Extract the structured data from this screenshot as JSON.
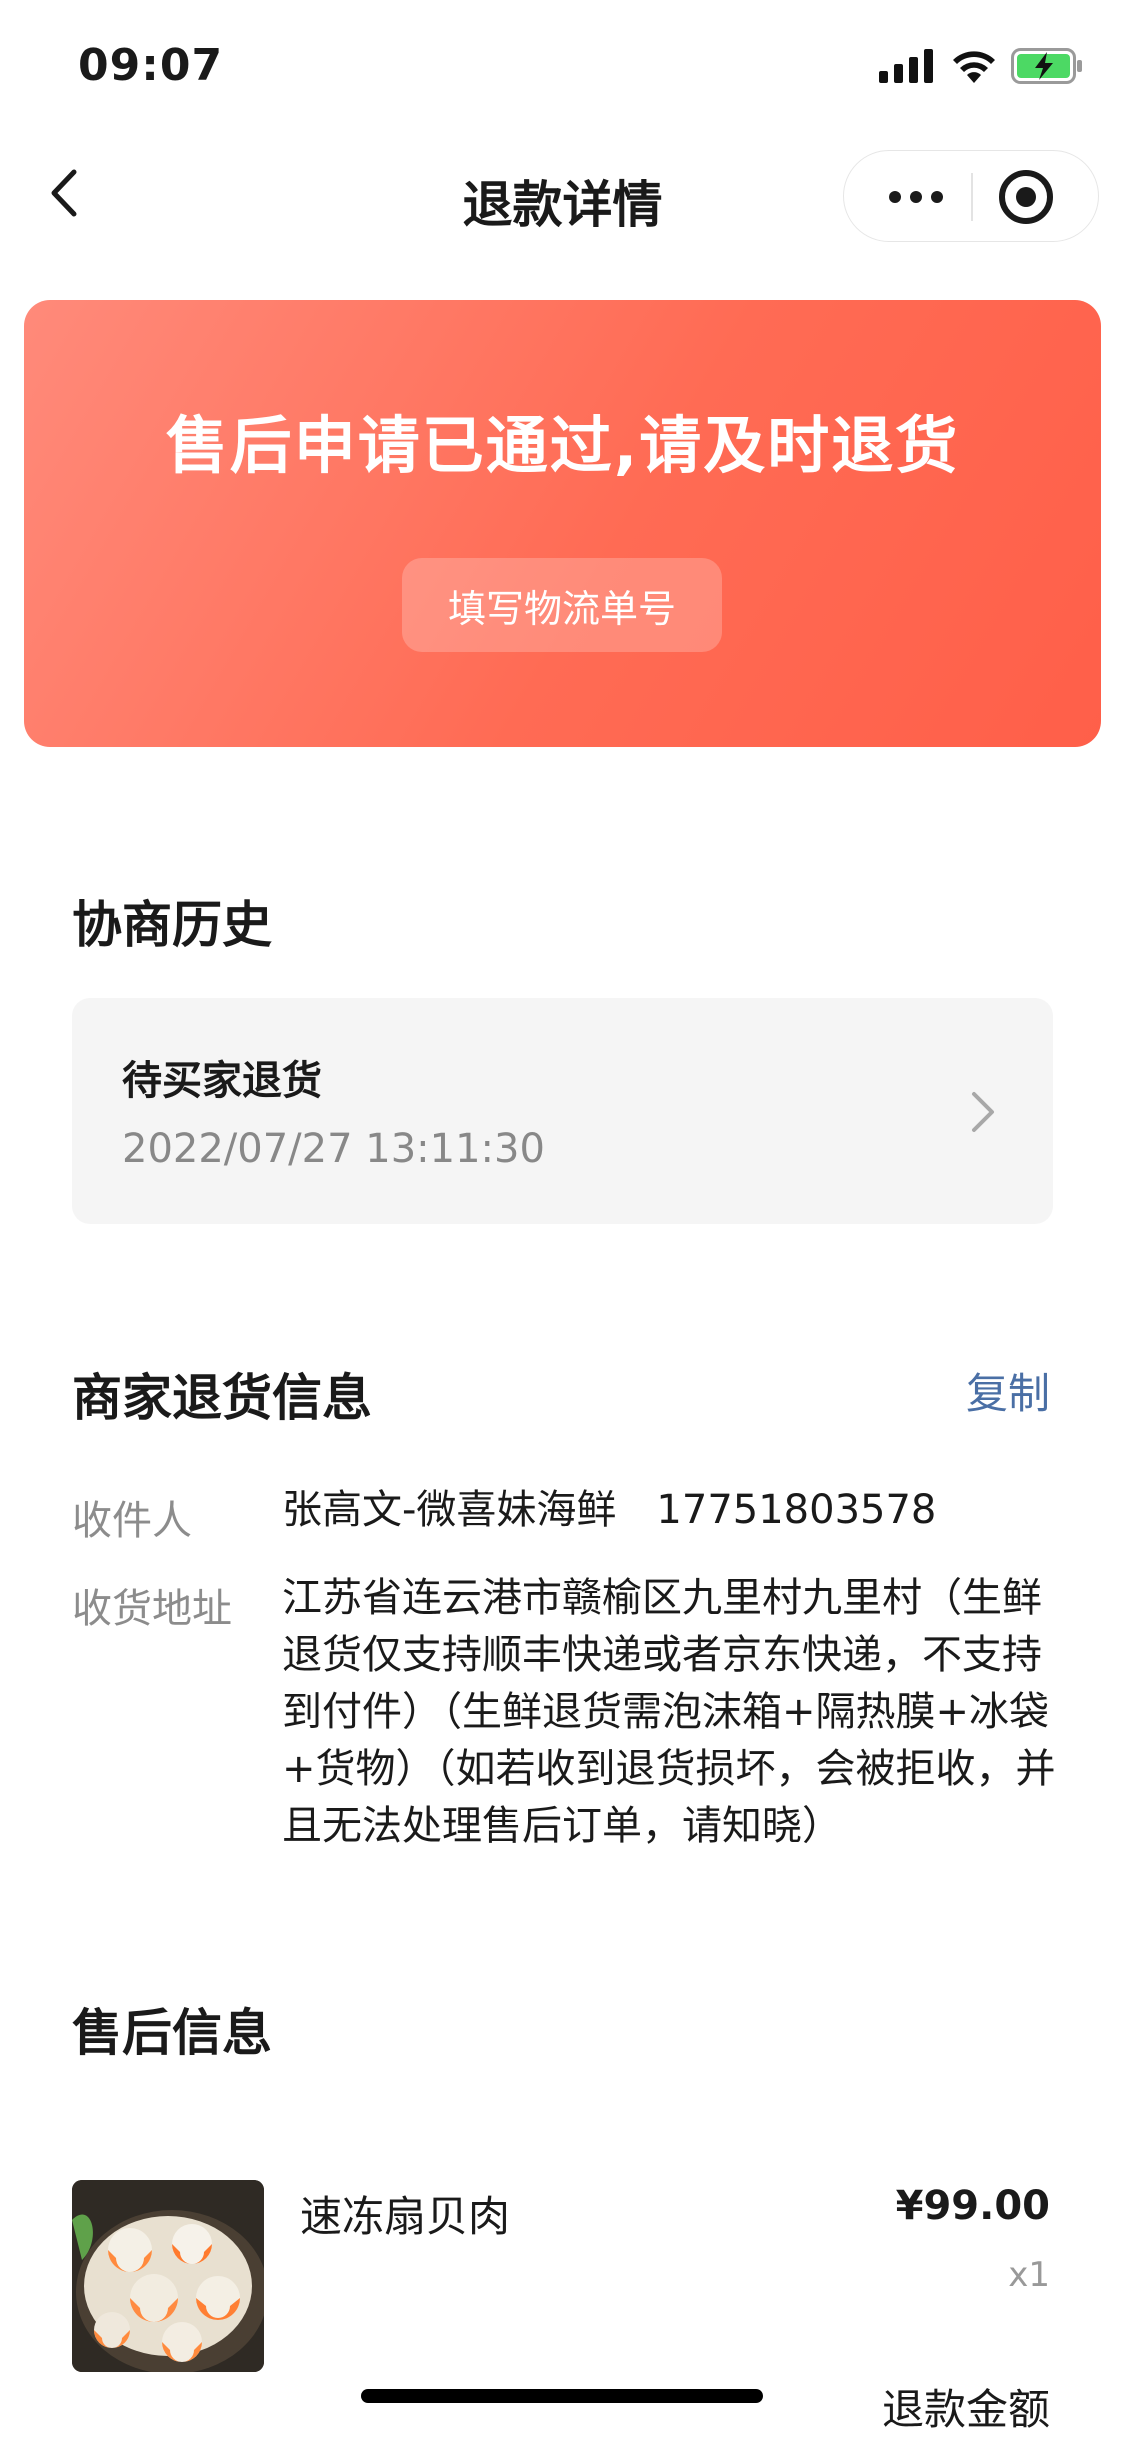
{
  "status_bar": {
    "time": "09:07",
    "icons": [
      "signal-icon",
      "wifi-icon",
      "battery-charging-icon"
    ]
  },
  "nav": {
    "title": "退款详情",
    "back_icon": "chevron-left-icon",
    "more_icon": "more-dots-icon",
    "target_icon": "target-icon"
  },
  "banner": {
    "title": "售后申请已通过,请及时退货",
    "button_label": "填写物流单号",
    "accent_color": "#ff6b54"
  },
  "history": {
    "section_title": "协商历史",
    "status": "待买家退货",
    "time": "2022/07/27 13:11:30"
  },
  "merchant": {
    "section_title": "商家退货信息",
    "copy_label": "复制",
    "recipient_label": "收件人",
    "recipient_value": "张高文-微喜妹海鲜　17751803578",
    "address_label": "收货地址",
    "address_value": "江苏省连云港市赣榆区九里村九里村（生鲜退货仅支持顺丰快递或者京东快递，不支持到付件）（生鲜退货需泡沫箱+隔热膜+冰袋+货物）（如若收到退货损坏，会被拒收，并且无法处理售后订单，请知晓）"
  },
  "aftersale": {
    "section_title": "售后信息",
    "product_name": "速冻扇贝肉",
    "price": "¥99.00",
    "quantity": "x1",
    "refund_label": "退款金额"
  }
}
